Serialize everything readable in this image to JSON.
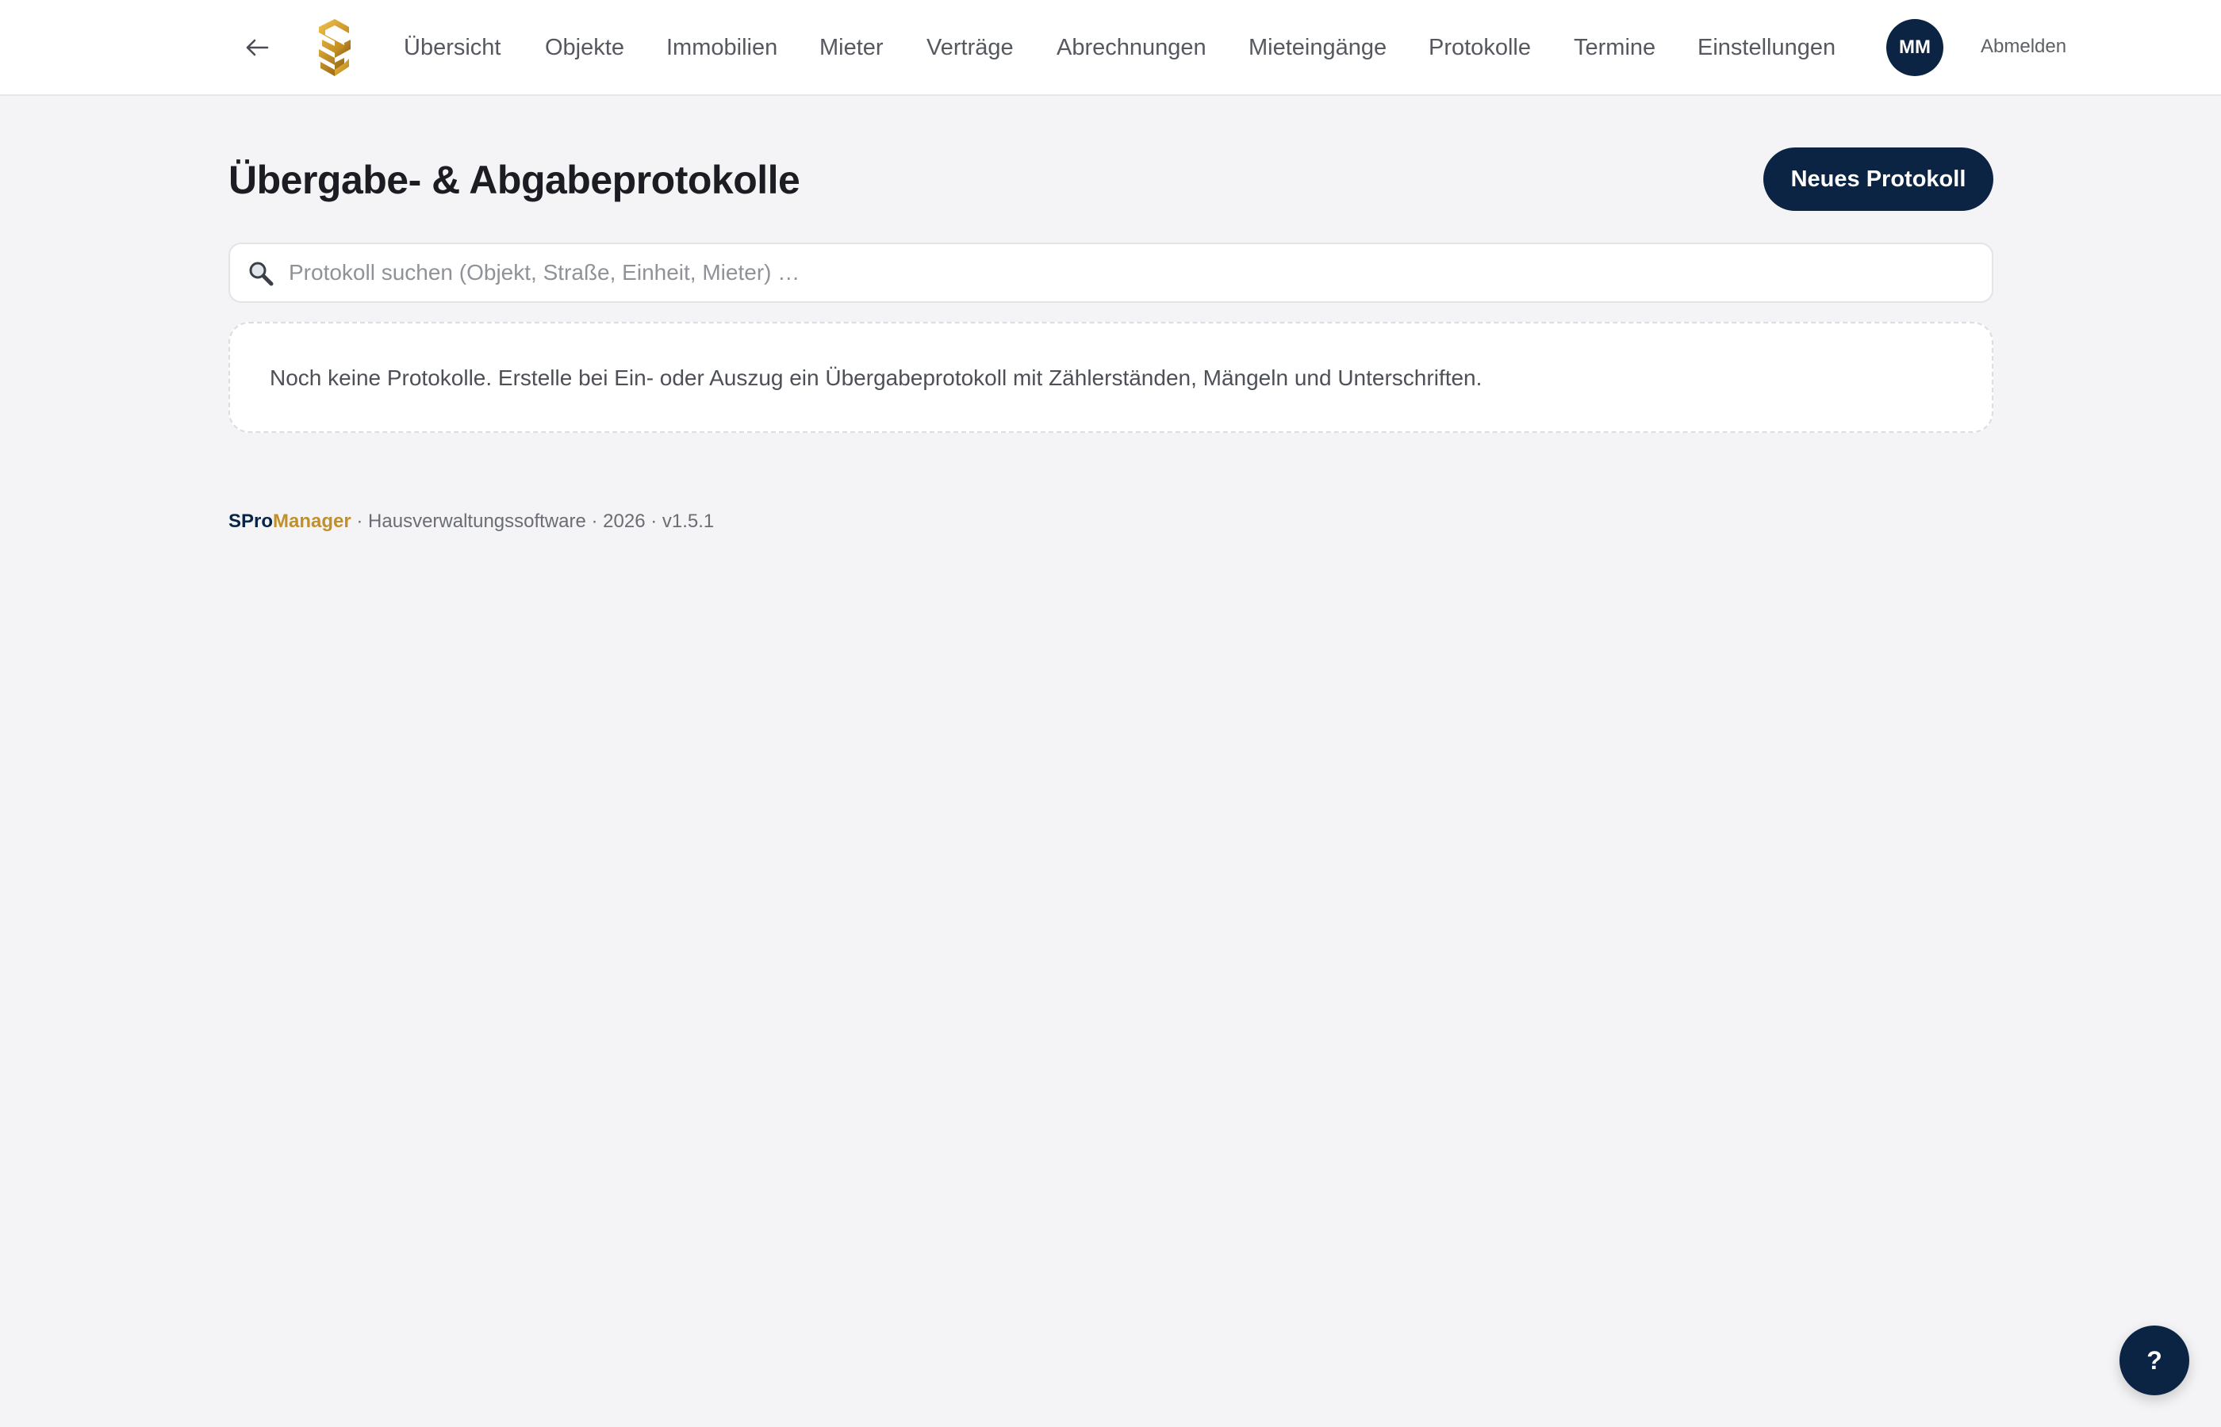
{
  "header": {
    "nav": [
      {
        "label": "Übersicht"
      },
      {
        "label": "Objekte"
      },
      {
        "label": "Immobilien"
      },
      {
        "label": "Mieter"
      },
      {
        "label": "Verträge"
      },
      {
        "label": "Abrechnungen"
      },
      {
        "label": "Mieteingänge"
      },
      {
        "label": "Protokolle"
      },
      {
        "label": "Termine"
      },
      {
        "label": "Einstellungen"
      }
    ],
    "avatar_initials": "MM",
    "logout_label": "Abmelden",
    "icons": {
      "back": "arrow-left-icon",
      "logo": "s-logo-icon"
    }
  },
  "main": {
    "title": "Übergabe- & Abgabeprotokolle",
    "new_button_label": "Neues Protokoll",
    "search": {
      "placeholder": "Protokoll suchen (Objekt, Straße, Einheit, Mieter) …",
      "value": "",
      "icon": "search-icon"
    },
    "empty_message": "Noch keine Protokolle. Erstelle bei Ein- oder Auszug ein Übergabeprotokoll mit Zählerständen, Mängeln und Unterschriften."
  },
  "footer": {
    "brand_part1": "SPro",
    "brand_part2": "Manager",
    "text": " · Hausverwaltungssoftware · 2026 · v1.5.1"
  },
  "help_button_label": "?",
  "colors": {
    "accent_navy": "#0b2444",
    "brand_gold": "#c2902a",
    "background": "#f4f4f6"
  }
}
